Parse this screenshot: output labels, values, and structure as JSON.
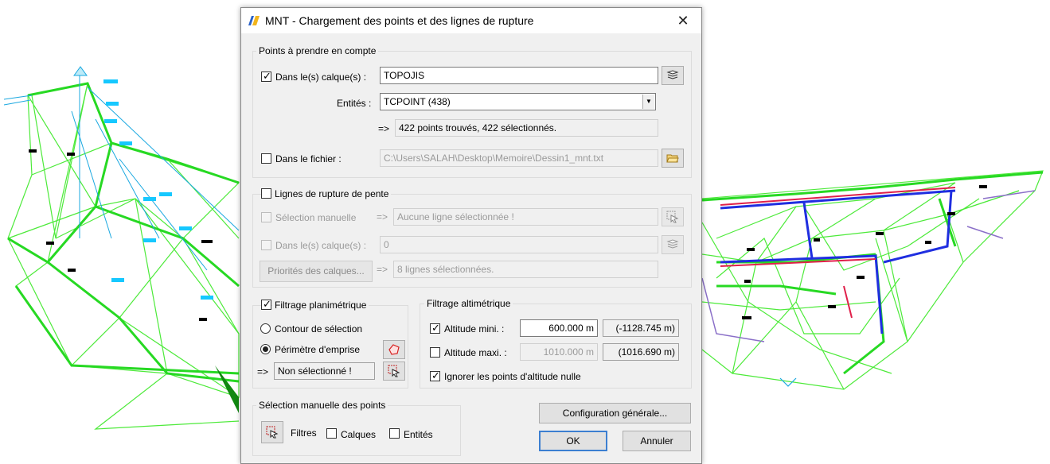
{
  "window": {
    "title": "MNT - Chargement des points et des lignes de rupture",
    "close_glyph": "✕"
  },
  "points_group": {
    "label": "Points à prendre en compte",
    "layers_checkbox": {
      "label": "Dans le(s) calque(s) :",
      "checked": true
    },
    "layers_value": "TOPOJIS",
    "entities_label": "Entités :",
    "entities_value": "TCPOINT (438)",
    "arrow": "=>",
    "found_text": "422 points trouvés, 422 sélectionnés.",
    "file_checkbox": {
      "label": "Dans le fichier :",
      "checked": false
    },
    "file_path": "C:\\Users\\SALAH\\Desktop\\Memoire\\Dessin1_mnt.txt"
  },
  "breaklines_group": {
    "label": "Lignes de rupture de pente",
    "checked": false,
    "manual_selection": {
      "label": "Sélection manuelle",
      "checked": false
    },
    "arrow": "=>",
    "manual_value": "Aucune ligne sélectionnée !",
    "layers_checkbox": {
      "label": "Dans le(s) calque(s) :",
      "checked": false
    },
    "layers_value": "0",
    "priorities_button": "Priorités des calques...",
    "lines_value": "8 lignes sélectionnées."
  },
  "planimetric": {
    "label": "Filtrage planimétrique",
    "checked": true,
    "radio_contour": "Contour de sélection",
    "radio_perimeter": "Périmètre d'emprise",
    "selected": "perimeter",
    "arrow": "=>",
    "status": "Non sélectionné !"
  },
  "altimetric": {
    "label": "Filtrage altimétrique",
    "min": {
      "label": "Altitude mini. :",
      "checked": true,
      "value": "600.000 m",
      "reference": "(-1128.745 m)"
    },
    "max": {
      "label": "Altitude maxi. :",
      "checked": false,
      "value": "1010.000 m",
      "reference": "(1016.690 m)"
    },
    "ignore_zero": {
      "label": "Ignorer les points d'altitude nulle",
      "checked": true
    }
  },
  "manual_points": {
    "label": "Sélection manuelle des points",
    "filters_label": "Filtres",
    "layers": {
      "label": "Calques",
      "checked": false
    },
    "entities": {
      "label": "Entités",
      "checked": false
    }
  },
  "buttons": {
    "config": "Configuration générale...",
    "ok": "OK",
    "cancel": "Annuler"
  },
  "colors": {
    "mesh": "#33ee33",
    "mesh_dark": "#1fcf1f",
    "cyan": "#00c8ff",
    "accent": "#3c7fd1"
  }
}
